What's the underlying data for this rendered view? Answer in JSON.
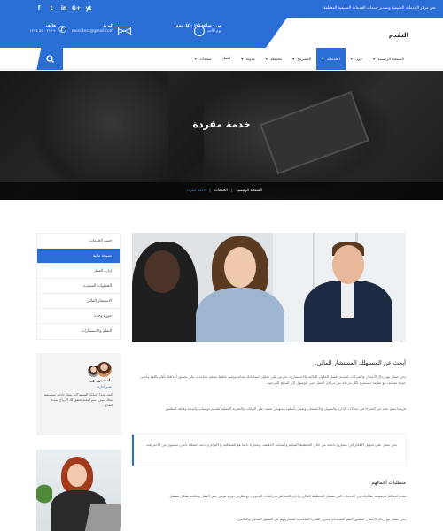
{
  "topbar": {
    "tagline": "نحن مركز الخدمات الطبيعية وتصدير خدمات الخدمات الطبيعية المختلفة",
    "social": [
      "f",
      "t",
      "in",
      "G+",
      "yt"
    ]
  },
  "header": {
    "logo": "التقدم",
    "phone_label": "هاتف",
    "phone_value": "+٢١٣ ٥٥٠ ١٢٣٤",
    "email_label": "البريد",
    "email_value": "moni.test@gmail.com",
    "hours_label": "من - ساعة (١٢ - كل يوم)",
    "hours_value": "يوم الأحد"
  },
  "nav": {
    "items": [
      {
        "label": "الصفحة الرئيسية",
        "caret": true
      },
      {
        "label": "حول",
        "caret": true
      },
      {
        "label": "الخدمات",
        "caret": true,
        "active": true
      },
      {
        "label": "المشروع",
        "caret": true
      },
      {
        "label": "محفظة",
        "caret": true
      },
      {
        "label": "مدونة",
        "caret": true
      },
      {
        "label": "اتصل",
        "caret": false
      },
      {
        "label": "صفحات",
        "caret": true
      }
    ]
  },
  "hero": {
    "title": "خدمة مفردة",
    "crumbs": [
      "الصفحة الرئيسية",
      "الخدمات",
      "خدمة مفردة"
    ]
  },
  "sidebar": {
    "menu": [
      "جميع الخدمات",
      "نصيحة مالية",
      "إدارة العمل",
      "الخطوات السعيدة",
      "الاستثمار المالي",
      "حوزة وحدة",
      "التعلم والاستشارات"
    ],
    "active_index": 1,
    "card": {
      "name": "ياسمين نور",
      "role": "مدير إدارة",
      "bio": "كيف تحول حياتك المهنية إلى عمل ناجح، سنستمع معك لنبني استراتيجية تحقق لك الأرباح بعيدة المدى."
    }
  },
  "content": {
    "heading": "أبحث عن المستهلك المستشار المالي.",
    "para1": "نحن نعمل مع رجال الأعمال والشركات لتقديم أفضل الحلول المالية والاستشارية، نحرص على تحليل احتياجاتك بعناية ووضع خطط عملية تساعدك على تحقيق أهدافك بأقل تكلفة وأعلى جودة ممكنة، مع متابعة مستمرة لكل مرحلة من مراحل العمل حتى الوصول إلى النتائج المرجوة.",
    "para2": "فريقنا يضم نخبة من الخبراء في مجالات الإدارة والتمويل والاستثمار، ويعمل بأسلوب منهجي يعتمد على البيانات والتجربة العملية لتقديم توصيات واضحة وقابلة للتطبيق.",
    "quote": "نحن نعمل على تحويل الأفكار إلى مشاريع ناجحة من خلال التخطيط السليم والمتابعة الدقيقة، وشعارنا دائما هو الشفافية والالتزام وخدمة العملاء بأعلى مستوى من الاحترافية.",
    "heading2": "منطلبات أعمالهم",
    "para3": "نقدم لعملائنا مجموعة متكاملة من الخدمات التي تشمل التخطيط المالي وإدارة المخاطر ودراسات الجدوى، مع تقارير دورية توضح سير العمل ونتائجه بشكل مفصل.",
    "para4": "نحن نعمل مع رجال الأعمال لتحقيق النمو المستدام وتعزيز القدرة التنافسية لمشاريعهم في السوق المحلي والعالمي."
  }
}
